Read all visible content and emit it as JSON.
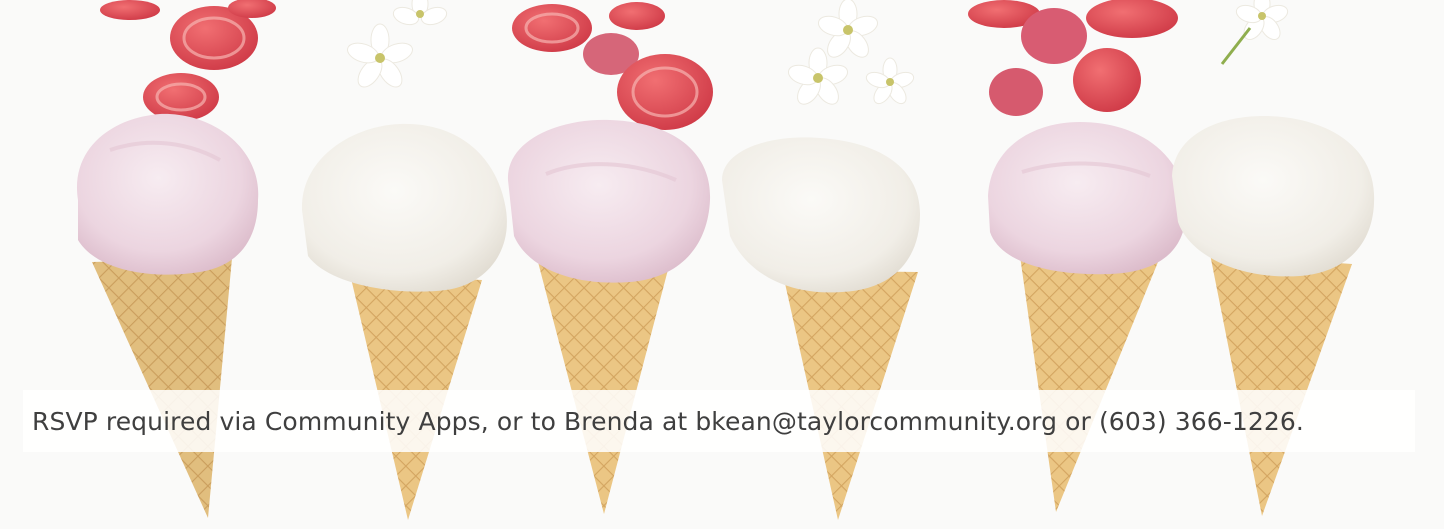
{
  "banner": {
    "caption": "RSVP required via Community Apps, or to Brenda at bkean@taylorcommunity.org or (603) 366-1226."
  },
  "photo": {
    "subject": "six ice cream cones with strawberries and white flowers",
    "cone_count": 6,
    "colors": {
      "background": "#fafaf9",
      "cone": "#e9c07c",
      "cone_shadow": "#d6a35c",
      "ice_cream_pink": "#f1dde6",
      "ice_cream_white": "#f6f3ee",
      "strawberry": "#e2545e",
      "flower_center": "#c8c46a"
    }
  }
}
